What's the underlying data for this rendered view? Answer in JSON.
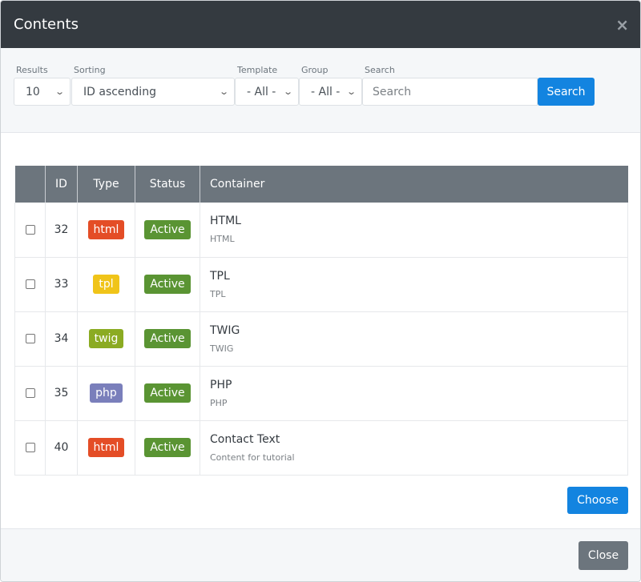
{
  "modal": {
    "title": "Contents",
    "close_icon": "×"
  },
  "filters": {
    "results": {
      "label": "Results",
      "value": "10"
    },
    "sorting": {
      "label": "Sorting",
      "value": "ID ascending"
    },
    "template": {
      "label": "Template",
      "value": "- All -"
    },
    "group": {
      "label": "Group",
      "value": "- All -"
    },
    "search": {
      "label": "Search",
      "placeholder": "Search",
      "value": ""
    },
    "search_button": "Search",
    "chevron": "⌄"
  },
  "table": {
    "columns": [
      "",
      "ID",
      "Type",
      "Status",
      "Container"
    ],
    "rows": [
      {
        "id": "32",
        "type": "html",
        "type_color": "#e44d26",
        "status": "Active",
        "status_color": "#5a9433",
        "title": "HTML",
        "subtitle": "HTML"
      },
      {
        "id": "33",
        "type": "tpl",
        "type_color": "#f0c419",
        "status": "Active",
        "status_color": "#5a9433",
        "title": "TPL",
        "subtitle": "TPL"
      },
      {
        "id": "34",
        "type": "twig",
        "type_color": "#8bab22",
        "status": "Active",
        "status_color": "#5a9433",
        "title": "TWIG",
        "subtitle": "TWIG"
      },
      {
        "id": "35",
        "type": "php",
        "type_color": "#7a7fbb",
        "status": "Active",
        "status_color": "#5a9433",
        "title": "PHP",
        "subtitle": "PHP"
      },
      {
        "id": "40",
        "type": "html",
        "type_color": "#e44d26",
        "status": "Active",
        "status_color": "#5a9433",
        "title": "Contact Text",
        "subtitle": "Content for tutorial"
      }
    ]
  },
  "actions": {
    "choose": "Choose",
    "close": "Close"
  },
  "colors": {
    "header_bg": "#343a40",
    "primary": "#1384e0",
    "secondary": "#6c757d"
  }
}
